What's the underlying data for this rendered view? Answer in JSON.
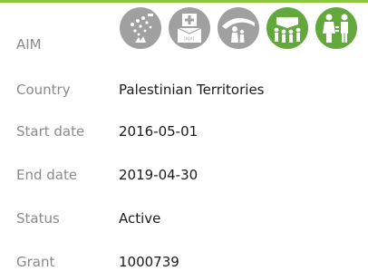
{
  "aim": {
    "label": "AIM",
    "icons": [
      {
        "name": "water-sanitation-icon",
        "color": "#a0a0a0"
      },
      {
        "name": "health-icon",
        "color": "#a0a0a0"
      },
      {
        "name": "protection-icon",
        "color": "#a0a0a0"
      },
      {
        "name": "community-mobilization-icon",
        "color": "#63a83c"
      },
      {
        "name": "gender-equality-icon",
        "color": "#63a83c"
      }
    ]
  },
  "details": [
    {
      "label": "Country",
      "value": "Palestinian Territories"
    },
    {
      "label": "Start date",
      "value": "2016-05-01"
    },
    {
      "label": "End date",
      "value": "2019-04-30"
    },
    {
      "label": "Status",
      "value": "Active"
    },
    {
      "label": "Grant",
      "value": "1000739"
    }
  ],
  "colors": {
    "accent": "#8dc63f",
    "inactive_icon": "#a0a0a0",
    "active_icon": "#63a83c"
  }
}
